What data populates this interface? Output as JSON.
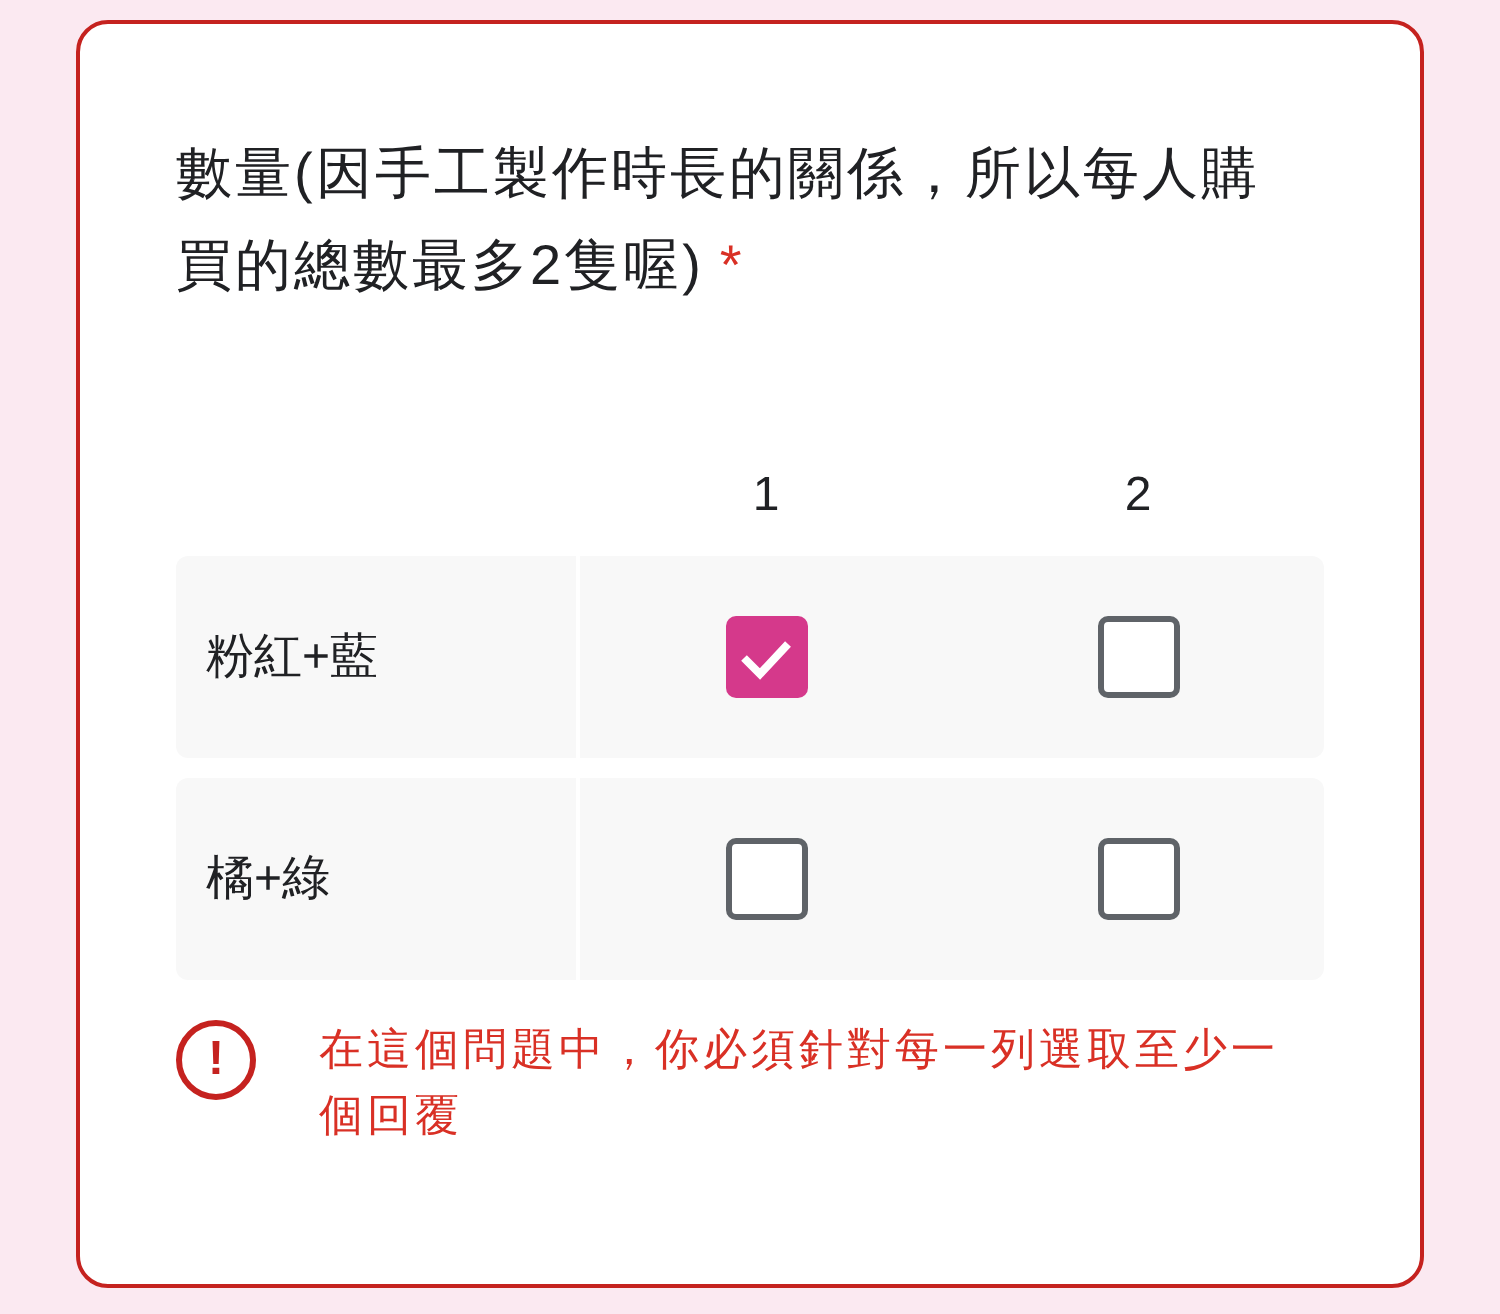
{
  "question": {
    "title": "數量(因手工製作時長的關係，所以每人購買的總數最多2隻喔)",
    "required": true,
    "required_mark": "*"
  },
  "columns": [
    "1",
    "2"
  ],
  "rows": [
    {
      "label": "粉紅+藍",
      "cells": [
        {
          "checked": true
        },
        {
          "checked": false
        }
      ]
    },
    {
      "label": "橘+綠",
      "cells": [
        {
          "checked": false
        },
        {
          "checked": false
        }
      ]
    }
  ],
  "error": {
    "icon": "!",
    "text": "在這個問題中，你必須針對每一列選取至少一個回覆"
  }
}
